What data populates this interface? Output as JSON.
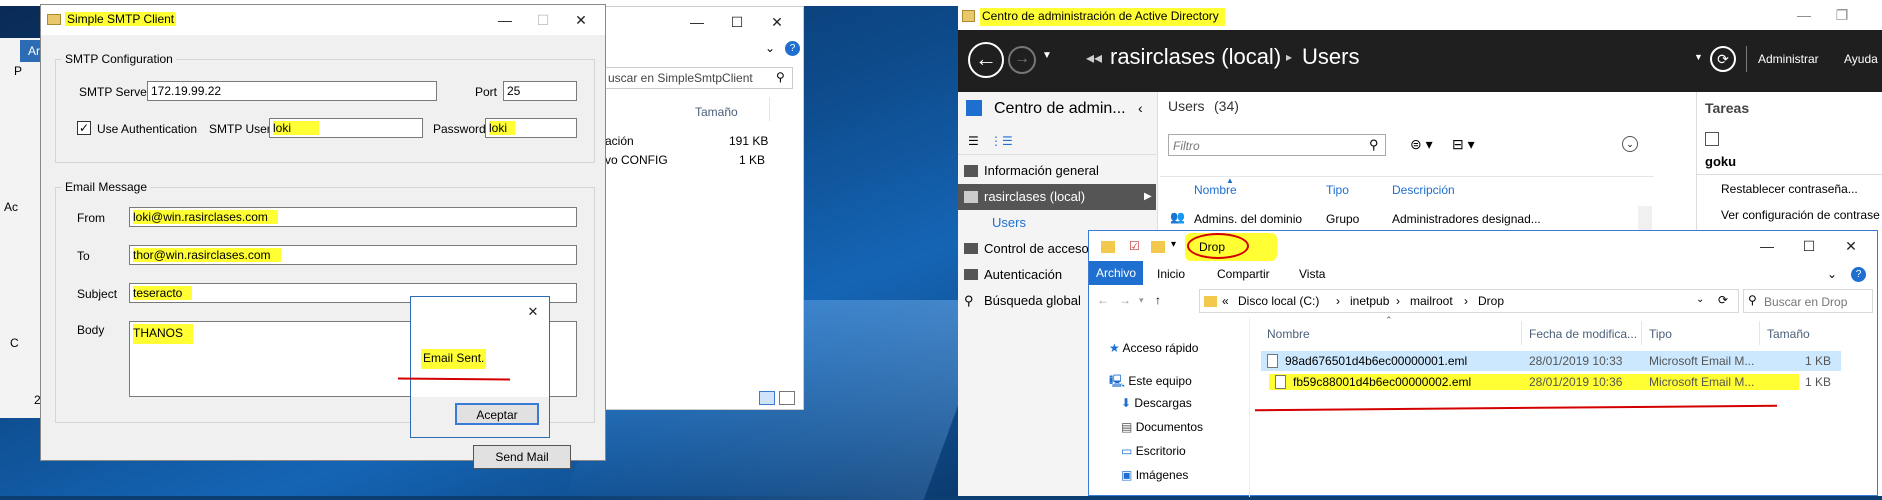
{
  "colors": {
    "desktop": "#0d3f73",
    "highlight": "#ffff33",
    "red_mark": "#d40000",
    "ad_dark": "#1f1f1f",
    "accent": "#0078d7",
    "selected_row": "#cce8ff"
  },
  "smtp": {
    "title": "Simple SMTP Client",
    "config_group": "SMTP Configuration",
    "server_label": "SMTP Server",
    "server_value": "172.19.99.22",
    "port_label": "Port",
    "port_value": "25",
    "use_auth_label": "Use Authentication",
    "use_auth_checked": true,
    "user_label": "SMTP User",
    "user_value": "loki",
    "password_label": "Password",
    "password_value": "loki",
    "message_group": "Email Message",
    "from_label": "From",
    "from_value": "loki@win.rasirclases.com",
    "to_label": "To",
    "to_value": "thor@win.rasirclases.com",
    "subject_label": "Subject",
    "subject_value": "teseracto",
    "body_label": "Body",
    "body_value": "THANOS",
    "send_button": "Send Mail"
  },
  "dialog": {
    "message": "Email Sent.",
    "ok_button": "Aceptar"
  },
  "bg_explorer": {
    "search_placeholder": "uscar en SimpleSmtpClient",
    "size_header": "Tamaño",
    "rows": [
      {
        "name": "ación",
        "size": "191 KB"
      },
      {
        "name": "vo CONFIG",
        "size": "1 KB"
      }
    ]
  },
  "desktop_fragments": {
    "a1": "Ar",
    "a2": "P",
    "a3": "Ac",
    "a4": "C",
    "a5": "2"
  },
  "ad": {
    "title": "Centro de administración de Active Directory",
    "breadcrumb_root": "rasirclases (local)",
    "breadcrumb_current": "Users",
    "manage": "Administrar",
    "help": "Ayuda",
    "nav_title": "Centro de admin...",
    "nav": [
      {
        "label": "Información general"
      },
      {
        "label": "rasirclases (local)"
      },
      {
        "label": "Users"
      },
      {
        "label": "Control de acceso d"
      },
      {
        "label": "Autenticación"
      },
      {
        "label": "Búsqueda global"
      }
    ],
    "list_title": "Users",
    "list_count": "(34)",
    "filter_placeholder": "Filtro",
    "columns": [
      "Nombre",
      "Tipo",
      "Descripción"
    ],
    "rows": [
      {
        "name": "Admins. del dominio",
        "type": "Grupo",
        "desc": "Administradores designad..."
      }
    ],
    "tasks_title": "Tareas",
    "task_object": "goku",
    "tasks": [
      "Restablecer contraseña...",
      "Ver configuración de contrase"
    ]
  },
  "explorer": {
    "title": "Drop",
    "ribbon": [
      "Archivo",
      "Inicio",
      "Compartir",
      "Vista"
    ],
    "path": [
      "«",
      "Disco local (C:)",
      "inetpub",
      "mailroot",
      "Drop"
    ],
    "search_placeholder": "Buscar en Drop",
    "nav": [
      {
        "label": "Acceso rápido"
      },
      {
        "label": "Este equipo"
      },
      {
        "label": "Descargas"
      },
      {
        "label": "Documentos"
      },
      {
        "label": "Escritorio"
      },
      {
        "label": "Imágenes"
      }
    ],
    "columns": [
      "Nombre",
      "Fecha de modifica...",
      "Tipo",
      "Tamaño"
    ],
    "files": [
      {
        "name": "98ad676501d4b6ec00000001.eml",
        "date": "28/01/2019 10:33",
        "type": "Microsoft Email M...",
        "size": "1 KB"
      },
      {
        "name": "fb59c88001d4b6ec00000002.eml",
        "date": "28/01/2019 10:36",
        "type": "Microsoft Email M...",
        "size": "1 KB"
      }
    ]
  }
}
